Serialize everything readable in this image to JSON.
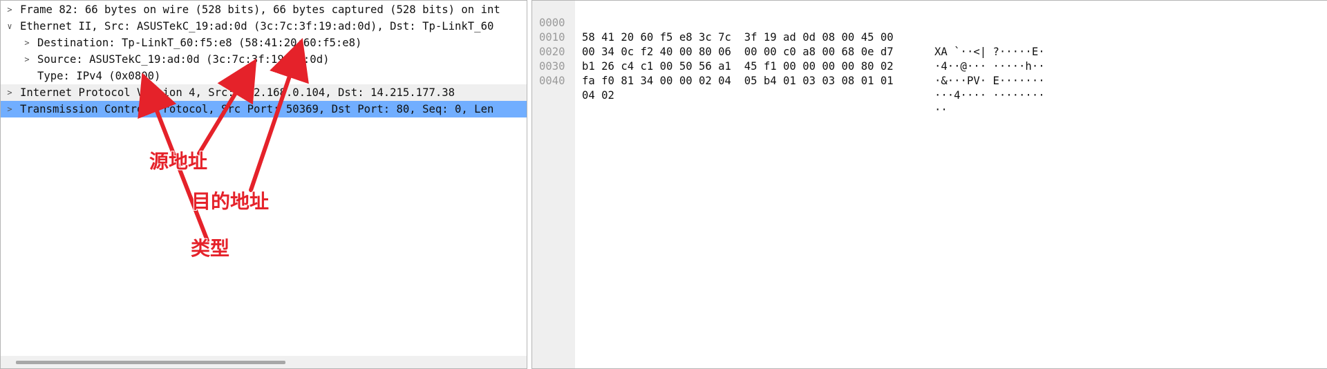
{
  "tree": {
    "rows": [
      {
        "arrow": ">",
        "text": "Frame 82: 66 bytes on wire (528 bits), 66 bytes captured (528 bits) on int"
      },
      {
        "arrow": "∨",
        "text": "Ethernet II, Src: ASUSTekC_19:ad:0d (3c:7c:3f:19:ad:0d), Dst: Tp-LinkT_60"
      },
      {
        "arrow": ">",
        "text": "Destination: Tp-LinkT_60:f5:e8 (58:41:20:60:f5:e8)"
      },
      {
        "arrow": ">",
        "text": "Source: ASUSTekC_19:ad:0d (3c:7c:3f:19:ad:0d)"
      },
      {
        "arrow": "",
        "text": "Type: IPv4 (0x0800)"
      },
      {
        "arrow": ">",
        "text": "Internet Protocol Version 4, Src: 192.168.0.104, Dst: 14.215.177.38"
      },
      {
        "arrow": ">",
        "text": "Transmission Control Protocol, Src Port: 50369, Dst Port: 80, Seq: 0, Len"
      }
    ]
  },
  "bytes": {
    "rows": [
      {
        "offset": "0000",
        "hex": "58 41 20 60 f5 e8 3c 7c  3f 19 ad 0d 08 00 45 00",
        "ascii": "XA `··<| ?·····E·"
      },
      {
        "offset": "0010",
        "hex": "00 34 0c f2 40 00 80 06  00 00 c0 a8 00 68 0e d7",
        "ascii": "·4··@··· ·····h··"
      },
      {
        "offset": "0020",
        "hex": "b1 26 c4 c1 00 50 56 a1  45 f1 00 00 00 00 80 02",
        "ascii": "·&···PV· E·······"
      },
      {
        "offset": "0030",
        "hex": "fa f0 81 34 00 00 02 04  05 b4 01 03 03 08 01 01",
        "ascii": "···4···· ········"
      },
      {
        "offset": "0040",
        "hex": "04 02",
        "ascii": "··"
      }
    ]
  },
  "annotations": {
    "source_label": "源地址",
    "destination_label": "目的地址",
    "type_label": "类型",
    "color": "#e5222a"
  }
}
